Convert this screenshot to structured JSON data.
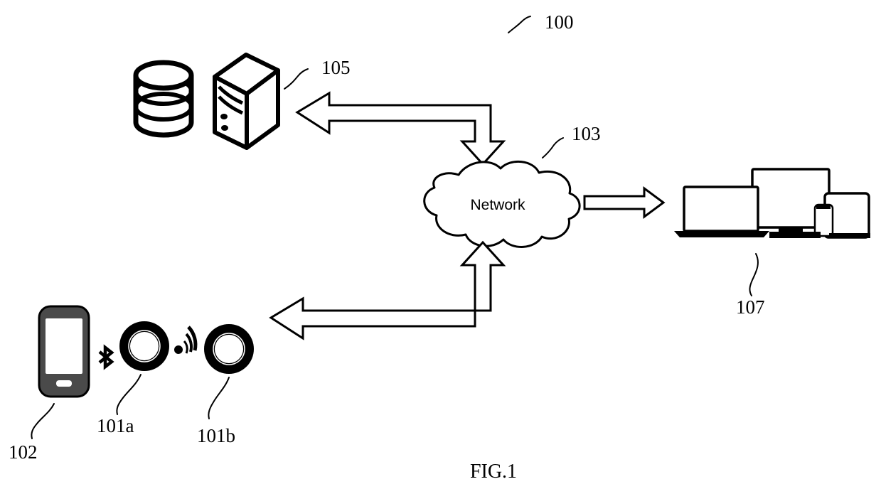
{
  "figure": {
    "caption": "FIG.1",
    "system_ref": "100",
    "background_color": "#ffffff",
    "line_color": "#000000"
  },
  "nodes": [
    {
      "id": "server",
      "ref": "105",
      "icon": "server-tower-with-database",
      "label": ""
    },
    {
      "id": "network",
      "ref": "103",
      "icon": "cloud",
      "label": "Network"
    },
    {
      "id": "client-devices",
      "ref": "107",
      "icon": "device-group-laptop-monitor-phone-tablet",
      "label": ""
    },
    {
      "id": "smartphone",
      "ref": "102",
      "icon": "smartphone",
      "label": ""
    },
    {
      "id": "speaker-a",
      "ref": "101a",
      "icon": "speaker-ring",
      "label": ""
    },
    {
      "id": "speaker-b",
      "ref": "101b",
      "icon": "speaker-ring",
      "label": ""
    }
  ],
  "connectors": [
    {
      "id": "server-network-link",
      "style": "hollow-elbow-double-arrow",
      "from": "network",
      "to": "server"
    },
    {
      "id": "network-devices-link",
      "style": "hollow-arrow-right",
      "from": "network",
      "to": "client-devices"
    },
    {
      "id": "network-speakers-link",
      "style": "hollow-elbow-double-arrow",
      "from": "network",
      "to": "speaker-b"
    },
    {
      "id": "bluetooth-link",
      "style": "bluetooth-glyph",
      "from": "smartphone",
      "to": "speaker-a"
    },
    {
      "id": "wireless-link",
      "style": "wireless-waves",
      "from": "speaker-a",
      "to": "speaker-b"
    }
  ]
}
